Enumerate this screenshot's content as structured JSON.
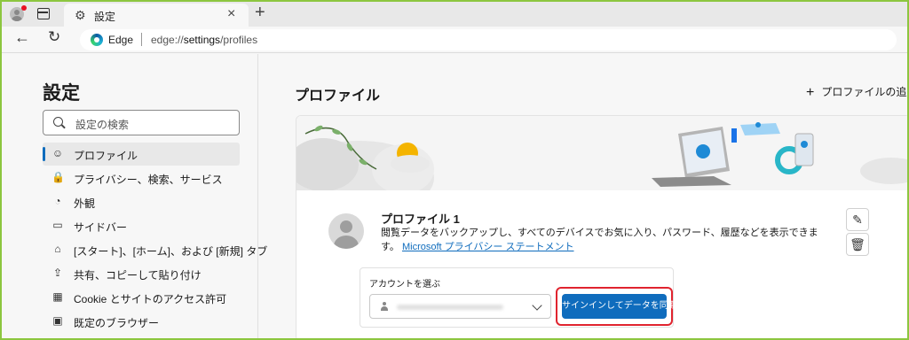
{
  "tab": {
    "title": "設定",
    "close": "×",
    "new_tab": "+"
  },
  "address_bar": {
    "site": "Edge",
    "url_prefix": "edge://",
    "url_path": "settings",
    "url_suffix": "/profiles"
  },
  "sidebar": {
    "title": "設定",
    "search_placeholder": "設定の検索",
    "items": [
      {
        "label": "プロファイル",
        "icon": "profile-icon",
        "glyph": "☺",
        "active": true
      },
      {
        "label": "プライバシー、検索、サービス",
        "icon": "lock-icon",
        "glyph": "🔒",
        "active": false
      },
      {
        "label": "外観",
        "icon": "appearance-icon",
        "glyph": "◔",
        "active": false
      },
      {
        "label": "サイドバー",
        "icon": "sidebar-icon",
        "glyph": "▭",
        "active": false
      },
      {
        "label": "[スタート]、[ホーム]、および [新規] タブ",
        "icon": "home-tab-icon",
        "glyph": "⌂",
        "active": false
      },
      {
        "label": "共有、コピーして貼り付け",
        "icon": "share-icon",
        "glyph": "⇪",
        "active": false
      },
      {
        "label": "Cookie とサイトのアクセス許可",
        "icon": "cookie-icon",
        "glyph": "▦",
        "active": false
      },
      {
        "label": "既定のブラウザー",
        "icon": "browser-icon",
        "glyph": "▣",
        "active": false
      }
    ]
  },
  "main": {
    "title": "プロファイル",
    "add_profile": "プロファイルの追加",
    "profile": {
      "name": "プロファイル 1",
      "description": "閲覧データをバックアップし、すべてのデバイスでお気に入り、パスワード、履歴などを表示できます。",
      "link": "Microsoft プライバシー ステートメント"
    },
    "account": {
      "label": "アカウントを選ぶ",
      "sync_button": "サインインしてデータを同期"
    }
  },
  "colors": {
    "accent": "#0f6cbd",
    "highlight": "#e0242f",
    "frame": "#8cc63f"
  }
}
